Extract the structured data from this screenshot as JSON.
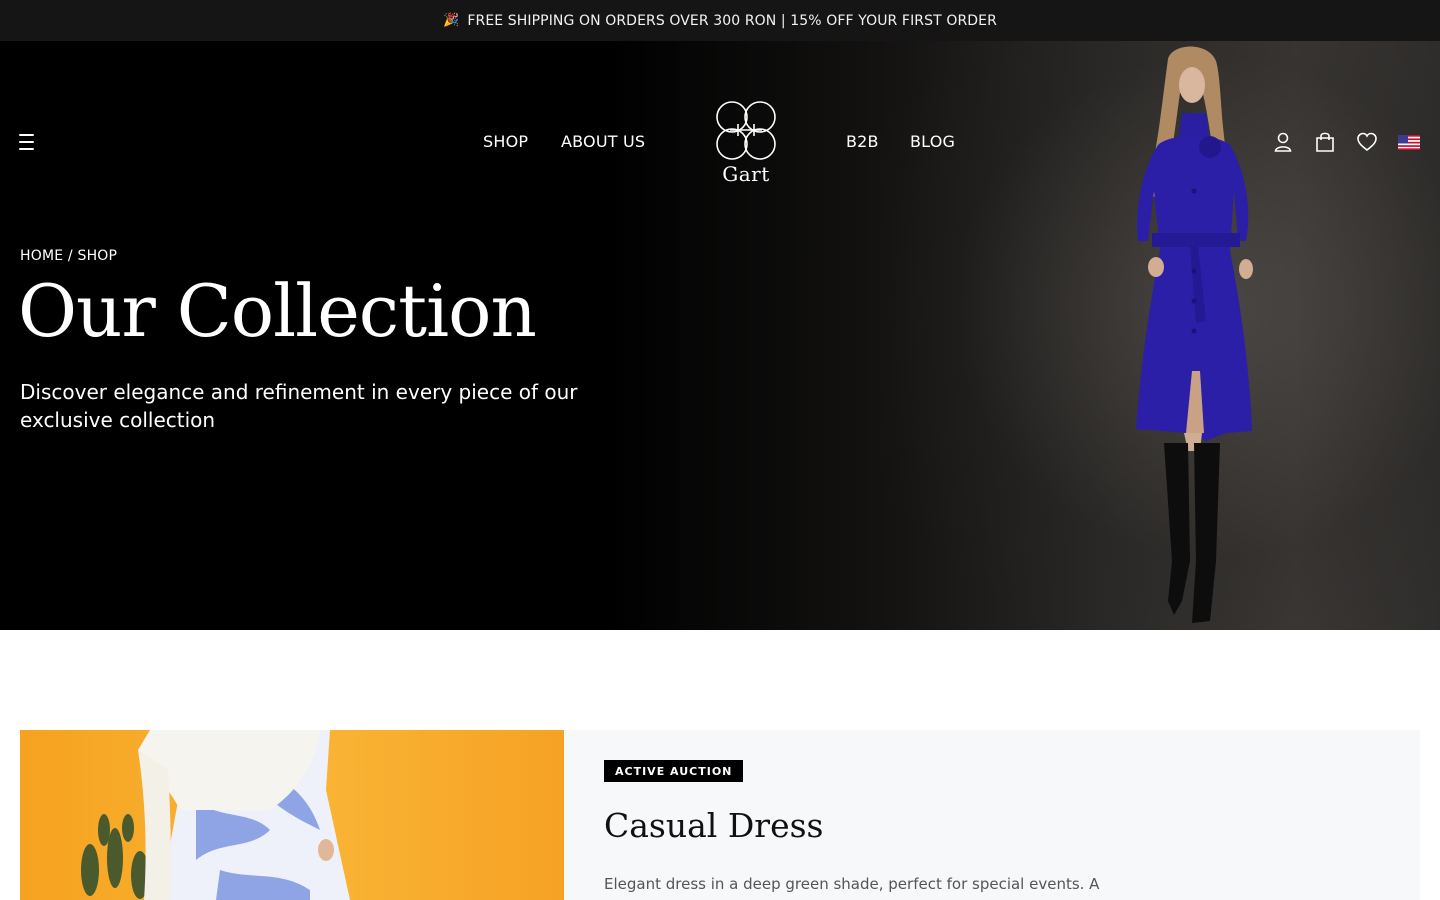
{
  "promo": {
    "icon": "party-popper-icon",
    "text": "FREE SHIPPING ON ORDERS OVER 300 RON | 15% OFF YOUR FIRST ORDER"
  },
  "header": {
    "nav_left": [
      "SHOP",
      "ABOUT US"
    ],
    "nav_right": [
      "B2B",
      "BLOG"
    ],
    "logo_text": "Gart",
    "icons": [
      "menu-icon",
      "user-icon",
      "shopping-bag-icon",
      "heart-icon",
      "us-flag-icon"
    ]
  },
  "hero": {
    "breadcrumb": "HOME / SHOP",
    "title": "Our Collection",
    "subtitle": "Discover elegance and refinement in every piece of our exclusive collection"
  },
  "product": {
    "badge": "ACTIVE AUCTION",
    "title": "Casual Dress",
    "description": "Elegant dress in a deep green shade, perfect for special events. A"
  },
  "colors": {
    "promo_bg": "#151515",
    "hero_bg": "#000000",
    "card_bg": "#f7f8fa",
    "product_image_bg": "#f9b233",
    "coat_blue": "#2b1fa8"
  }
}
